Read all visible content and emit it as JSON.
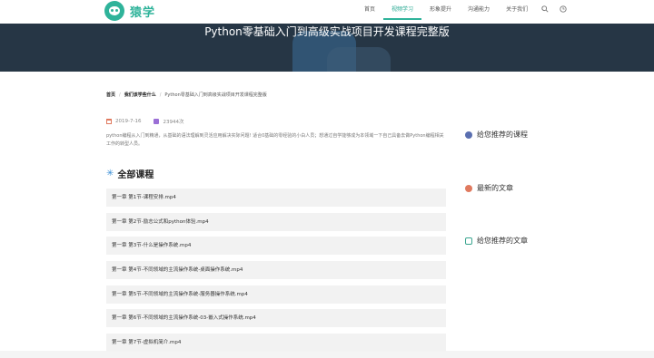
{
  "header": {
    "logo_text": "猿学",
    "nav": [
      "首页",
      "视频学习",
      "形象提升",
      "沟通能力",
      "关于我们"
    ]
  },
  "banner": {
    "title": "Python零基础入门到高级实战项目开发课程完整版"
  },
  "breadcrumb": {
    "home": "首页",
    "category": "我们该学些什么",
    "current": "Python零基础入门到高级实战项目开发课程完整版"
  },
  "meta": {
    "date": "2019-7-16",
    "views": "23944次"
  },
  "description": "python编程从入门到精通，从基础的语法理解到灵活应用解决实际问题! 适合0基础的零经验的小白人员；想通过自学能够成为本领域一下自己具备去做Python编程相关工作的转型人员。",
  "section_title": "全部课程",
  "lessons": [
    "第一章 第1节-课程安排.mp4",
    "第一章 第2节-励志公式和python体验.mp4",
    "第一章 第3节-什么是操作系统.mp4",
    "第一章 第4节-不同领域的主流操作系统-桌面操作系统.mp4",
    "第一章 第5节-不同领域的主流操作系统-服务器操作系统.mp4",
    "第一章 第6节-不同领域的主流操作系统-03-嵌入式操作系统.mp4",
    "第一章 第7节-虚拟机简介.mp4"
  ],
  "sidebar": {
    "recommended_courses": "给您推荐的课程",
    "latest_articles": "最新的文章",
    "recommended_articles": "给您推荐的文章"
  },
  "colors": {
    "accent": "#2fb39a",
    "banner": "#263645"
  },
  "icons": [
    "search-icon",
    "clock-icon",
    "calendar-icon",
    "eye-icon",
    "sparkle-icon"
  ]
}
